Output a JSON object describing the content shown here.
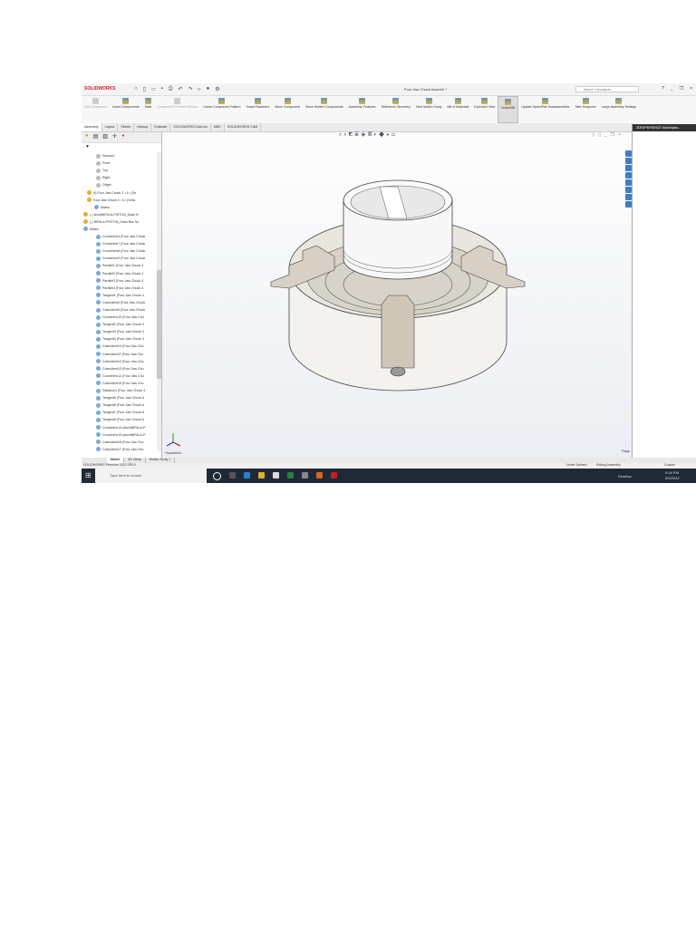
{
  "app": {
    "logo": "SOLIDWORKS",
    "title": "Four Jaw Chuck Assem2 *",
    "search_placeholder": "Search Commands"
  },
  "ribbon": [
    "Edit Component",
    "Insert Components",
    "Mate",
    "Component Preview Window",
    "Linear Component Pattern",
    "Smart Fasteners",
    "Move Component",
    "Show Hidden Components",
    "Assembly Features",
    "Reference Geometry",
    "New Motion Study",
    "Bill of Materials",
    "Exploded View",
    "Instant3D",
    "Update SpeedPak Subassemblies",
    "Take Snapshot",
    "Large Assembly Settings"
  ],
  "tabs": [
    "Assembly",
    "Layout",
    "Sketch",
    "Markup",
    "Evaluate",
    "SOLIDWORKS Add-Ins",
    "MBD",
    "SOLIDWORKS CAM"
  ],
  "tree": [
    "Sensors",
    "Front",
    "Top",
    "Right",
    "Origin",
    "(f) Four Jaw Chuck 1 <1> (De",
    "Four Jaw Chuck 2 <1> (Defa",
    "Mates",
    "(-) stockBIFALA-PISTON_Dado B",
    "(-) BIFALA-PISTON_Dado Buil Su",
    "Mates",
    "Concentric4 (Four Jaw Chuck",
    "Concentric7 (Four Jaw Chuck",
    "Concentric8 (Four Jaw Chuck",
    "Concentric9 (Four Jaw Chuck",
    "Parallel1 (Four Jaw Chuck 4",
    "Parallel2 (Four Jaw Chuck 4",
    "Parallel3 (Four Jaw Chuck 4",
    "Parallel4 (Four Jaw Chuck 4",
    "Tangent1 (Four Jaw Chuck 4",
    "Coincident4 (Four Jaw Chuck",
    "Coincident5 (Four Jaw Chuck",
    "Concentric10 (Four Jaw Chu",
    "Tangent2 (Four Jaw Chuck 4",
    "Tangent3 (Four Jaw Chuck 4",
    "Tangent4 (Four Jaw Chuck 4",
    "Coincident10 (Four Jaw Chu",
    "Coincident11 (Four Jaw Chu",
    "Coincident12 (Four Jaw Chu",
    "Coincident13 (Four Jaw Chu",
    "Concentric12 (Four Jaw Chu",
    "Coincident15 (Four Jaw Chu",
    "Distance1 (Four Jaw Chuck 4",
    "Tangent5 (Four Jaw Chuck A",
    "Tangent6 (Four Jaw Chuck A",
    "Tangent7 (Four Jaw Chuck A",
    "Tangent8 (Four Jaw Chuck A",
    "Concentric14 (stockBIFALA-P",
    "Concentric15 (stockBIFALA-P",
    "Coincident16 (Four Jaw Chu",
    "Coincident17 (Four Jaw Chu"
  ],
  "view": {
    "orientation": "*Isometric",
    "flags_label": "Flags:"
  },
  "right_panel": {
    "title": "3DEXPERIENCE Marketplac..."
  },
  "bottom_tabs": [
    "Model",
    "3D Views",
    "Motion Study 1"
  ],
  "status": {
    "product": "SOLIDWORKS Premium 2021 SP0.0",
    "state": "Under Defined",
    "mode": "Editing Assembly",
    "units": "Custom"
  },
  "taskbar": {
    "search": "Type here to search",
    "desktop": "Desktop",
    "time": "5:34 PM",
    "date": "5/5/2022"
  }
}
